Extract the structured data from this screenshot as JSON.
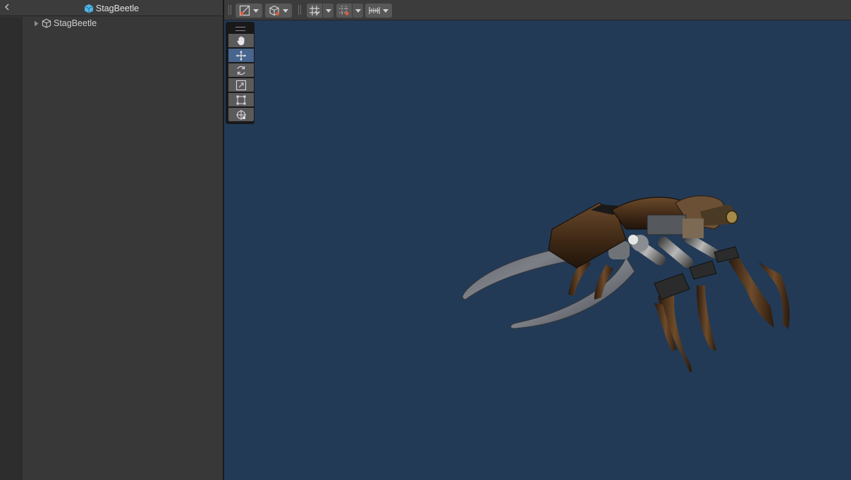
{
  "hierarchy": {
    "title": "StagBeetle",
    "items": [
      {
        "label": "StagBeetle",
        "expanded": false
      }
    ]
  },
  "scene": {
    "toolbar": {
      "draw_mode": "draw-mode-icon",
      "shading": "cube-icon",
      "grid_snap": "grid-icon",
      "incremental_snap": "snap-grid-icon",
      "ruler": "ruler-icon"
    },
    "tools": {
      "items": [
        "hand-tool",
        "move-tool",
        "rotate-tool",
        "scale-tool",
        "rect-tool",
        "transform-tool"
      ],
      "active": "move-tool"
    },
    "model": "stag-beetle",
    "colors": {
      "background": "#223a56",
      "tool_active": "#48658d",
      "accent_cube": "#4fb4e6"
    }
  }
}
